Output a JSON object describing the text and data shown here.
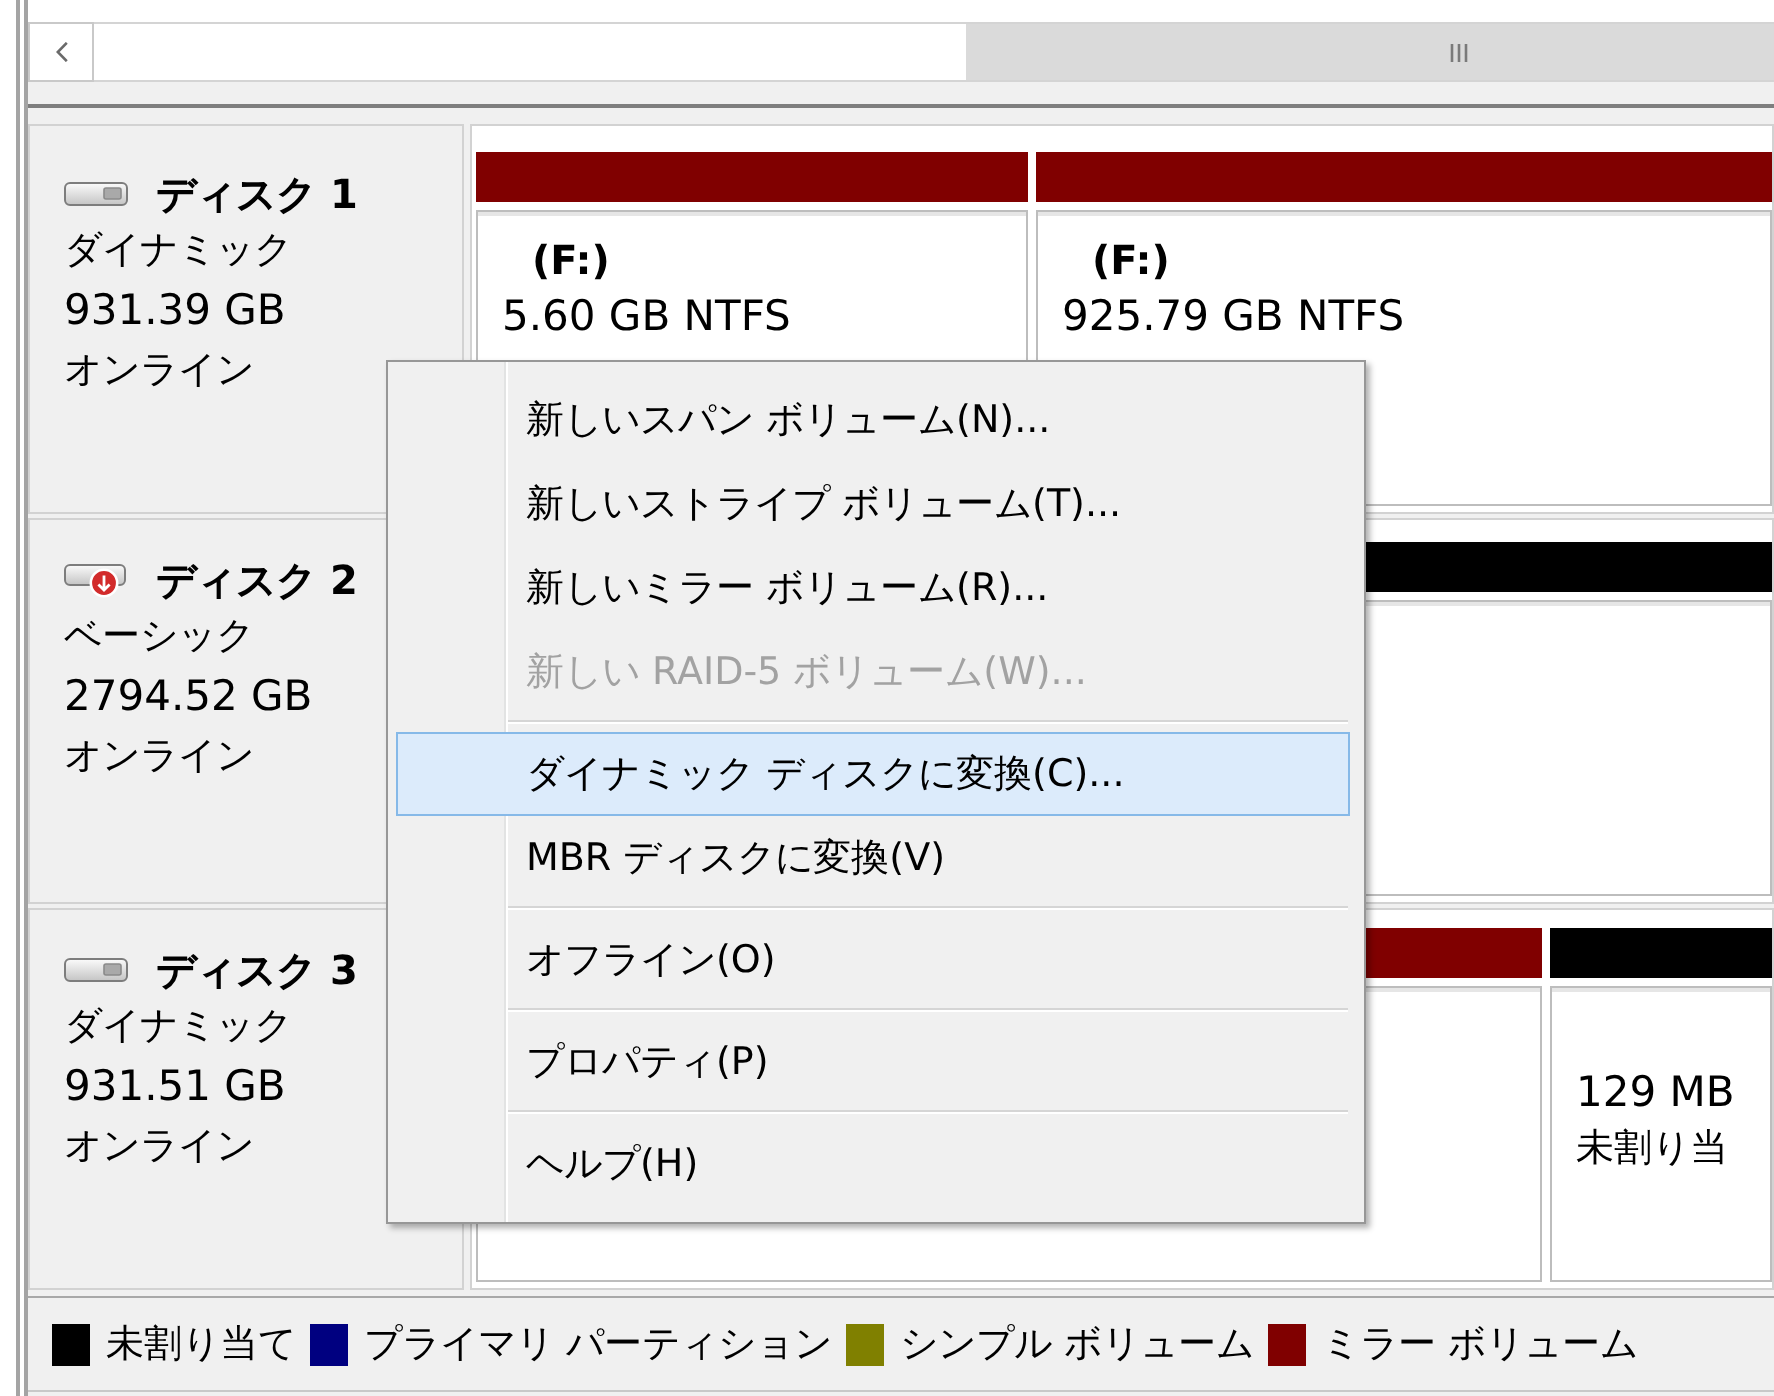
{
  "disks": [
    {
      "kind": "dynamic",
      "name": "ディスク 1",
      "type": "ダイナミック",
      "capacity": "931.39 GB",
      "status": "オンライン",
      "partitions": [
        {
          "color": "#800000",
          "label": "(F:)",
          "size": "5.60 GB NTFS"
        },
        {
          "color": "#800000",
          "label": "(F:)",
          "size": "925.79 GB NTFS"
        }
      ]
    },
    {
      "kind": "basic",
      "name": "ディスク 2",
      "type": "ベーシック",
      "capacity": "2794.52 GB",
      "status": "オンライン",
      "partitions": [
        {
          "color": "#000000"
        }
      ]
    },
    {
      "kind": "dynamic",
      "name": "ディスク 3",
      "type": "ダイナミック",
      "capacity": "931.51 GB",
      "status": "オンライン",
      "partitions": [
        {
          "color": "#800000"
        },
        {
          "color": "#000000",
          "size": "129 MB",
          "status": "未割り当"
        }
      ]
    }
  ],
  "context_menu": {
    "groups": [
      [
        {
          "label": "新しいスパン ボリューム(N)...",
          "selected": false,
          "disabled": false
        },
        {
          "label": "新しいストライプ ボリューム(T)...",
          "selected": false,
          "disabled": false
        },
        {
          "label": "新しいミラー ボリューム(R)...",
          "selected": false,
          "disabled": false
        },
        {
          "label": "新しい RAID-5 ボリューム(W)...",
          "selected": false,
          "disabled": true
        }
      ],
      [
        {
          "label": "ダイナミック ディスクに変換(C)...",
          "selected": true,
          "disabled": false
        },
        {
          "label": "MBR ディスクに変換(V)",
          "selected": false,
          "disabled": false
        }
      ],
      [
        {
          "label": "オフライン(O)",
          "selected": false,
          "disabled": false
        }
      ],
      [
        {
          "label": "プロパティ(P)",
          "selected": false,
          "disabled": false
        }
      ],
      [
        {
          "label": "ヘルプ(H)",
          "selected": false,
          "disabled": false
        }
      ]
    ]
  },
  "legend": [
    {
      "label": "未割り当て",
      "color": "#000000"
    },
    {
      "label": "プライマリ パーティション",
      "color": "#000080"
    },
    {
      "label": "シンプル ボリューム",
      "color": "#808000"
    },
    {
      "label": "ミラー ボリューム",
      "color": "#800000"
    }
  ]
}
